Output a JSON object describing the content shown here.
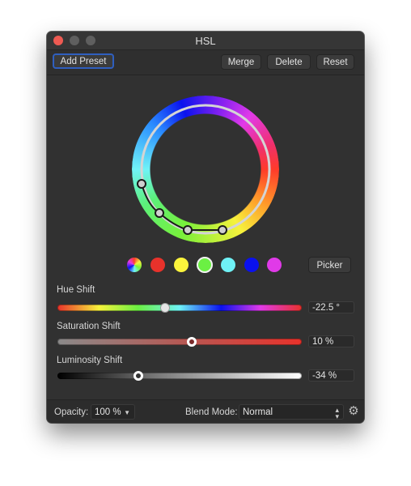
{
  "window": {
    "title": "HSL",
    "controls": [
      "close",
      "minimize",
      "maximize"
    ]
  },
  "toolbar": {
    "add_preset_label": "Add Preset",
    "merge_label": "Merge",
    "delete_label": "Delete",
    "reset_label": "Reset"
  },
  "wheel": {
    "icon": "hue-wheel",
    "control_points_count": 4
  },
  "swatches": {
    "items": [
      {
        "name": "master",
        "color": "multicolor"
      },
      {
        "name": "red",
        "color": "#e8322b"
      },
      {
        "name": "yellow",
        "color": "#fbf43c"
      },
      {
        "name": "green",
        "color": "#6bf043",
        "selected": true
      },
      {
        "name": "cyan",
        "color": "#6ff2f6"
      },
      {
        "name": "blue",
        "color": "#0a11ee"
      },
      {
        "name": "magenta",
        "color": "#e03ae8"
      }
    ],
    "picker_label": "Picker"
  },
  "sliders": {
    "hue": {
      "label": "Hue Shift",
      "value": "-22.5 °",
      "fraction": 0.44
    },
    "saturation": {
      "label": "Saturation Shift",
      "value": "10 %",
      "fraction": 0.55
    },
    "luminosity": {
      "label": "Luminosity Shift",
      "value": "-34 %",
      "fraction": 0.33
    }
  },
  "footer": {
    "opacity_label": "Opacity:",
    "opacity_value": "100 %",
    "blend_label": "Blend Mode:",
    "blend_value": "Normal",
    "settings_icon": "gear"
  }
}
